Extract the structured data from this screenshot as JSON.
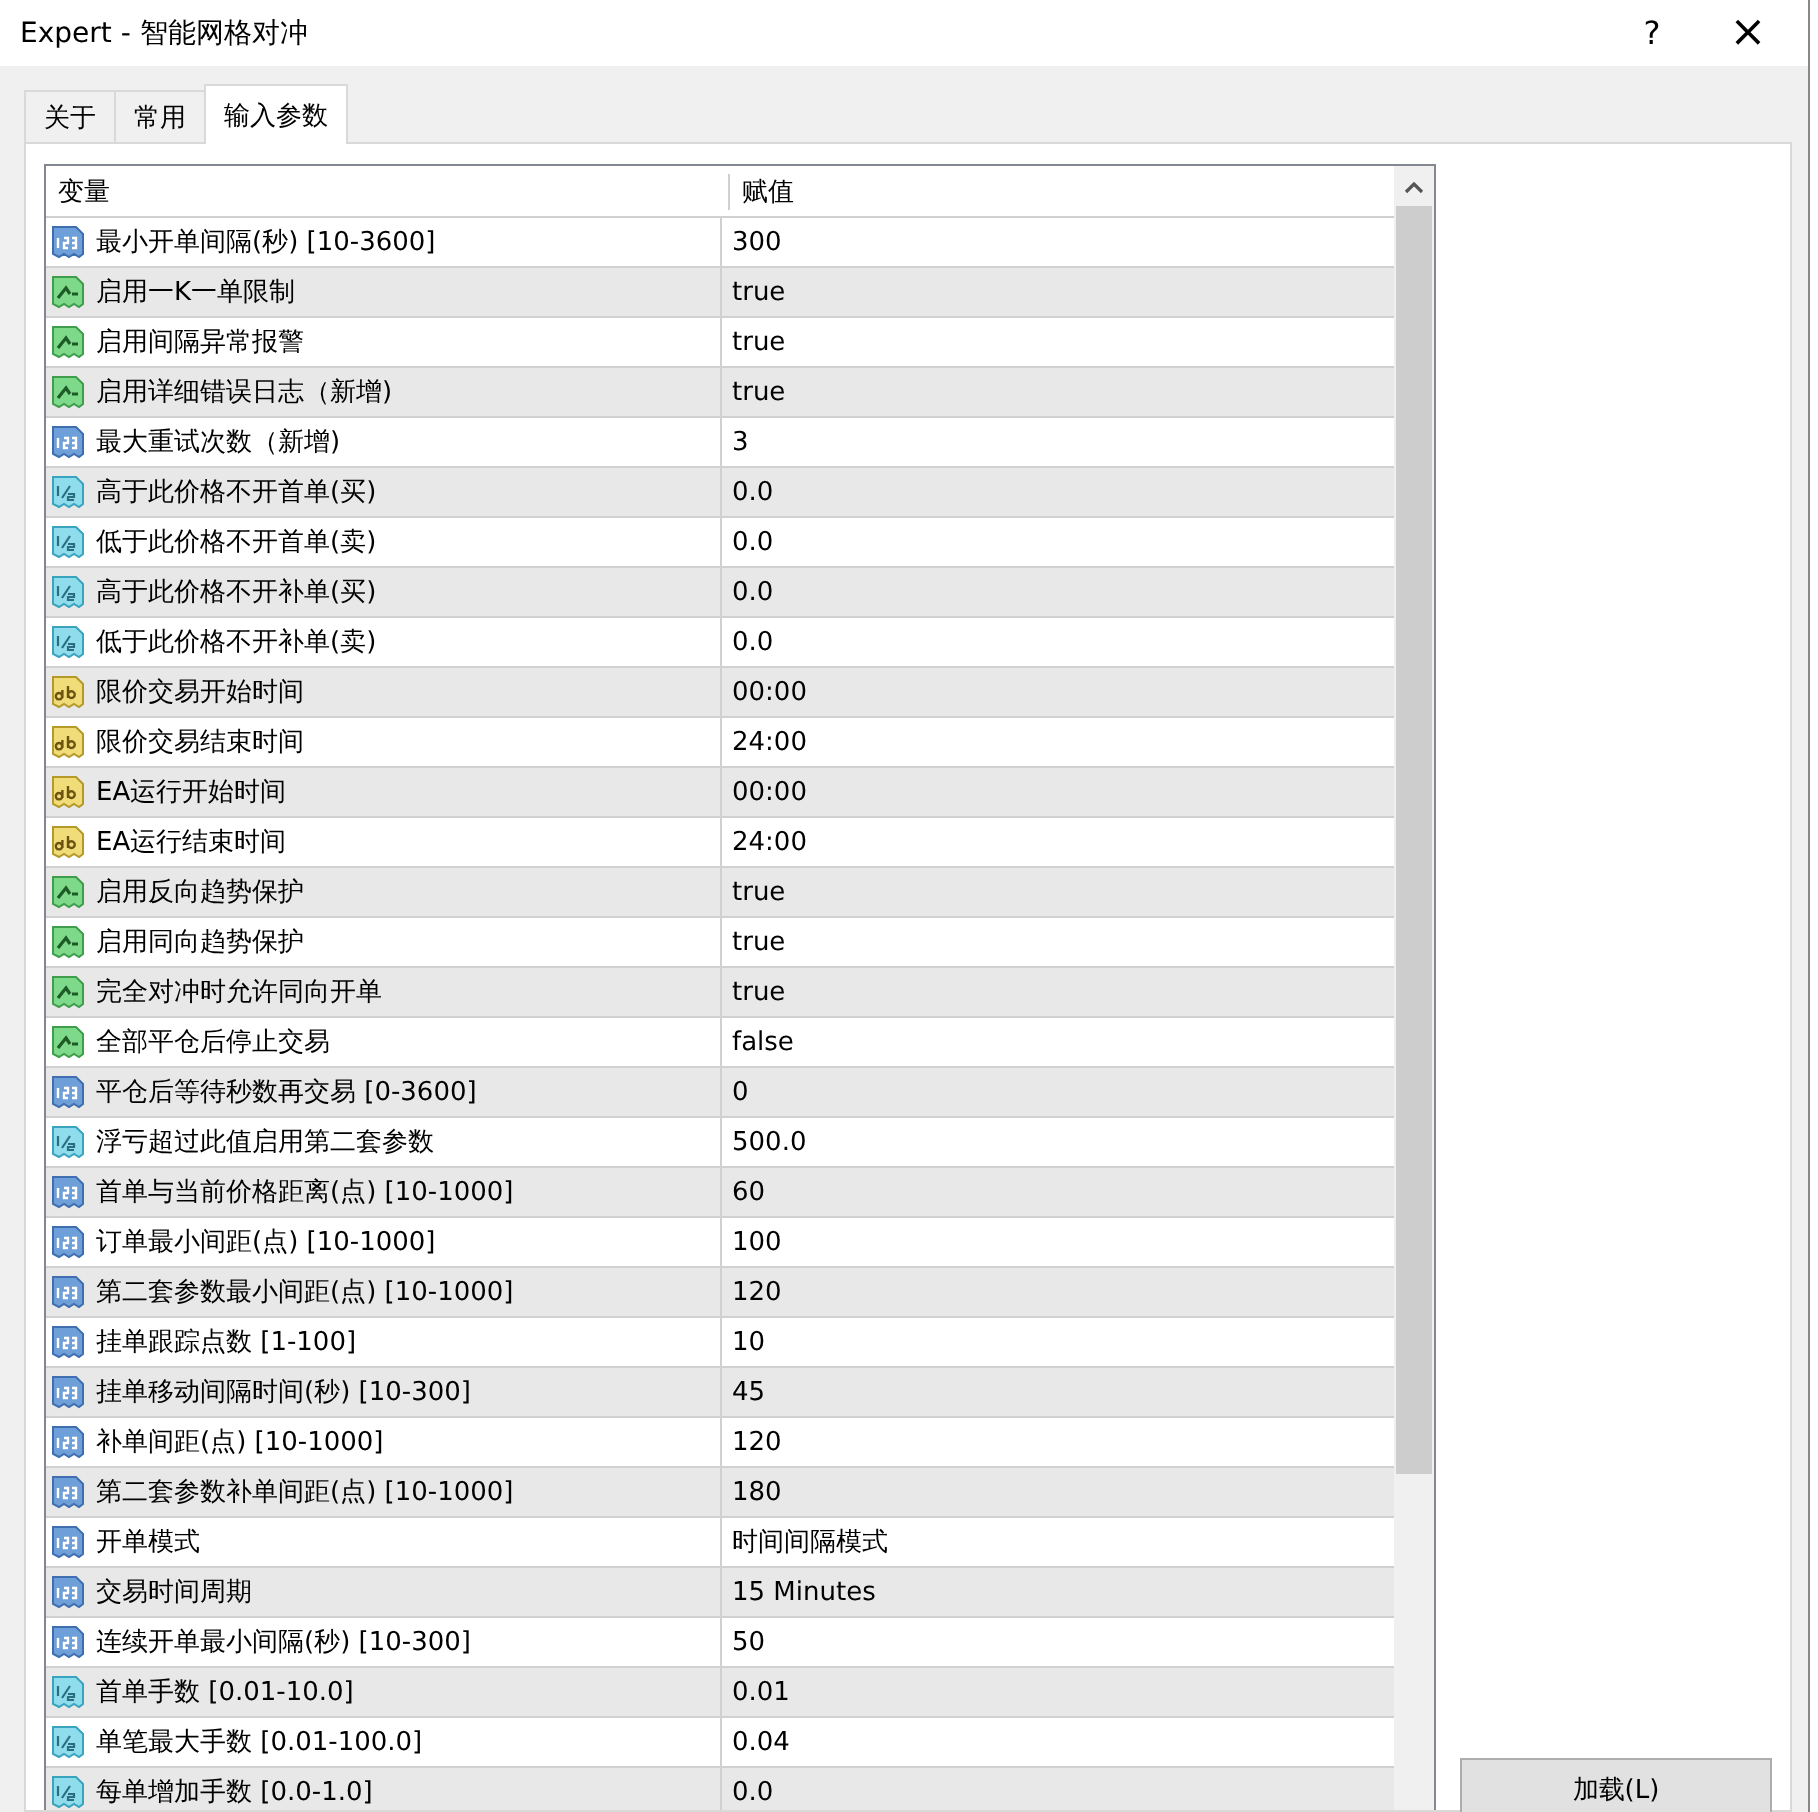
{
  "window": {
    "title": "Expert - 智能网格对冲",
    "help": "?",
    "close": "×"
  },
  "tabs": [
    {
      "label": "关于",
      "selected": false
    },
    {
      "label": "常用",
      "selected": false
    },
    {
      "label": "输入参数",
      "selected": true
    }
  ],
  "table": {
    "columns": [
      "变量",
      "赋值"
    ],
    "rows": [
      {
        "kind": "int",
        "name": "最小开单间隔(秒) [10-3600]",
        "value": "300"
      },
      {
        "kind": "bool",
        "name": "启用一K一单限制",
        "value": "true"
      },
      {
        "kind": "bool",
        "name": "启用间隔异常报警",
        "value": "true"
      },
      {
        "kind": "bool",
        "name": "启用详细错误日志（新增)",
        "value": "true"
      },
      {
        "kind": "int",
        "name": "最大重试次数（新增)",
        "value": "3"
      },
      {
        "kind": "double",
        "name": "高于此价格不开首单(买)",
        "value": "0.0"
      },
      {
        "kind": "double",
        "name": "低于此价格不开首单(卖)",
        "value": "0.0"
      },
      {
        "kind": "double",
        "name": "高于此价格不开补单(买)",
        "value": "0.0"
      },
      {
        "kind": "double",
        "name": "低于此价格不开补单(卖)",
        "value": "0.0"
      },
      {
        "kind": "string",
        "name": "限价交易开始时间",
        "value": "00:00"
      },
      {
        "kind": "string",
        "name": "限价交易结束时间",
        "value": "24:00"
      },
      {
        "kind": "string",
        "name": "EA运行开始时间",
        "value": "00:00"
      },
      {
        "kind": "string",
        "name": "EA运行结束时间",
        "value": "24:00"
      },
      {
        "kind": "bool",
        "name": "启用反向趋势保护",
        "value": "true"
      },
      {
        "kind": "bool",
        "name": "启用同向趋势保护",
        "value": "true"
      },
      {
        "kind": "bool",
        "name": "完全对冲时允许同向开单",
        "value": "true"
      },
      {
        "kind": "bool",
        "name": "全部平仓后停止交易",
        "value": "false"
      },
      {
        "kind": "int",
        "name": "平仓后等待秒数再交易 [0-3600]",
        "value": "0"
      },
      {
        "kind": "double",
        "name": "浮亏超过此值启用第二套参数",
        "value": "500.0"
      },
      {
        "kind": "int",
        "name": "首单与当前价格距离(点) [10-1000]",
        "value": "60"
      },
      {
        "kind": "int",
        "name": "订单最小间距(点) [10-1000]",
        "value": "100"
      },
      {
        "kind": "int",
        "name": "第二套参数最小间距(点) [10-1000]",
        "value": "120"
      },
      {
        "kind": "int",
        "name": "挂单跟踪点数 [1-100]",
        "value": "10"
      },
      {
        "kind": "int",
        "name": "挂单移动间隔时间(秒) [10-300]",
        "value": "45"
      },
      {
        "kind": "int",
        "name": "补单间距(点) [10-1000]",
        "value": "120"
      },
      {
        "kind": "int",
        "name": "第二套参数补单间距(点) [10-1000]",
        "value": "180"
      },
      {
        "kind": "int",
        "name": "开单模式",
        "value": "时间间隔模式"
      },
      {
        "kind": "int",
        "name": "交易时间周期",
        "value": "15 Minutes"
      },
      {
        "kind": "int",
        "name": "连续开单最小间隔(秒) [10-300]",
        "value": "50"
      },
      {
        "kind": "double",
        "name": "首单手数 [0.01-10.0]",
        "value": "0.01"
      },
      {
        "kind": "double",
        "name": "单笔最大手数 [0.01-100.0]",
        "value": "0.04"
      },
      {
        "kind": "double",
        "name": "每单增加手数 [0.0-1.0]",
        "value": "0.0"
      }
    ]
  },
  "buttons": [
    {
      "label": "加载(L)"
    }
  ]
}
